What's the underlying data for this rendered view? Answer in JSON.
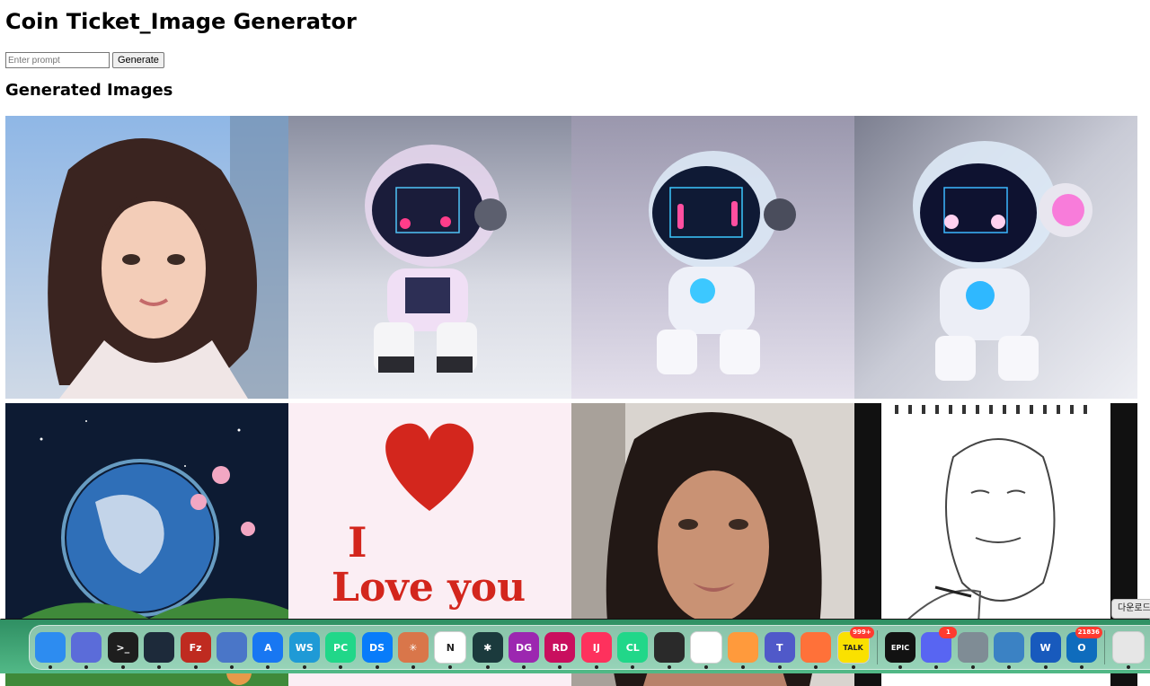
{
  "page": {
    "title": "Coin Ticket_Image Generator",
    "prompt_placeholder": "Enter prompt",
    "prompt_value": "",
    "generate_label": "Generate",
    "section_title": "Generated Images"
  },
  "gallery": {
    "images": [
      {
        "subject": "young woman portrait by window"
      },
      {
        "subject": "pink translucent robot"
      },
      {
        "subject": "blue translucent robot"
      },
      {
        "subject": "robot with neon headphones"
      },
      {
        "subject": "earth in space with flowers"
      },
      {
        "subject": "heart love you poster",
        "text_line1": "I",
        "text_line2": "Love you"
      },
      {
        "subject": "woman with dark hair portrait"
      },
      {
        "subject": "pencil sketch of smiling man"
      }
    ]
  },
  "dock": {
    "apps": [
      {
        "name": "finder-icon",
        "label": "",
        "color": "#2d8cf0"
      },
      {
        "name": "notes-icon",
        "label": "",
        "color": "#5b6cd9"
      },
      {
        "name": "terminal-icon",
        "label": ">_",
        "color": "#1e1e1e"
      },
      {
        "name": "cloud-icon",
        "label": "",
        "color": "#1d2a3a"
      },
      {
        "name": "filezilla-icon",
        "label": "Fz",
        "color": "#bf2b20"
      },
      {
        "name": "blueprint-icon",
        "label": "",
        "color": "#4a76c8"
      },
      {
        "name": "xcode-icon",
        "label": "A",
        "color": "#1877f2"
      },
      {
        "name": "webstorm-icon",
        "label": "WS",
        "color": "#1f9ad6"
      },
      {
        "name": "pycharm-icon",
        "label": "PC",
        "color": "#21d789"
      },
      {
        "name": "dataspell-icon",
        "label": "DS",
        "color": "#087cfa"
      },
      {
        "name": "claude-icon",
        "label": "✳",
        "color": "#d9764a"
      },
      {
        "name": "notion-icon",
        "label": "N",
        "color": "#ffffff"
      },
      {
        "name": "perplexity-icon",
        "label": "✱",
        "color": "#1b3a3d"
      },
      {
        "name": "datagrip-icon",
        "label": "DG",
        "color": "#9c27b0"
      },
      {
        "name": "rider-icon",
        "label": "RD",
        "color": "#c90f5e"
      },
      {
        "name": "intellij-icon",
        "label": "IJ",
        "color": "#fe315d"
      },
      {
        "name": "clion-icon",
        "label": "CL",
        "color": "#21d789"
      },
      {
        "name": "unity-icon",
        "label": "",
        "color": "#2a2a2a"
      },
      {
        "name": "chrome-icon",
        "label": "",
        "color": "#ffffff"
      },
      {
        "name": "emoji-app-icon",
        "label": "",
        "color": "#ff9a3c"
      },
      {
        "name": "teams-icon",
        "label": "T",
        "color": "#5059c9"
      },
      {
        "name": "firefox-icon",
        "label": "",
        "color": "#ff7139"
      },
      {
        "name": "kakaotalk-icon",
        "label": "TALK",
        "color": "#fae100",
        "badge": "999+"
      },
      {
        "name": "epic-games-icon",
        "label": "EPIC",
        "color": "#121212"
      },
      {
        "name": "discord-icon",
        "label": "",
        "color": "#5865f2",
        "badge": "1"
      },
      {
        "name": "system-prefs-icon",
        "label": "",
        "color": "#7f8c95"
      },
      {
        "name": "dashboard-icon",
        "label": "",
        "color": "#3b82c4"
      },
      {
        "name": "word-icon",
        "label": "W",
        "color": "#185abd"
      },
      {
        "name": "outlook-icon",
        "label": "O",
        "color": "#0f6cbd",
        "badge": "21836"
      },
      {
        "name": "downloads-stack-icon",
        "label": "",
        "color": "#e6e6e6"
      }
    ],
    "tooltip": "다운로드"
  }
}
